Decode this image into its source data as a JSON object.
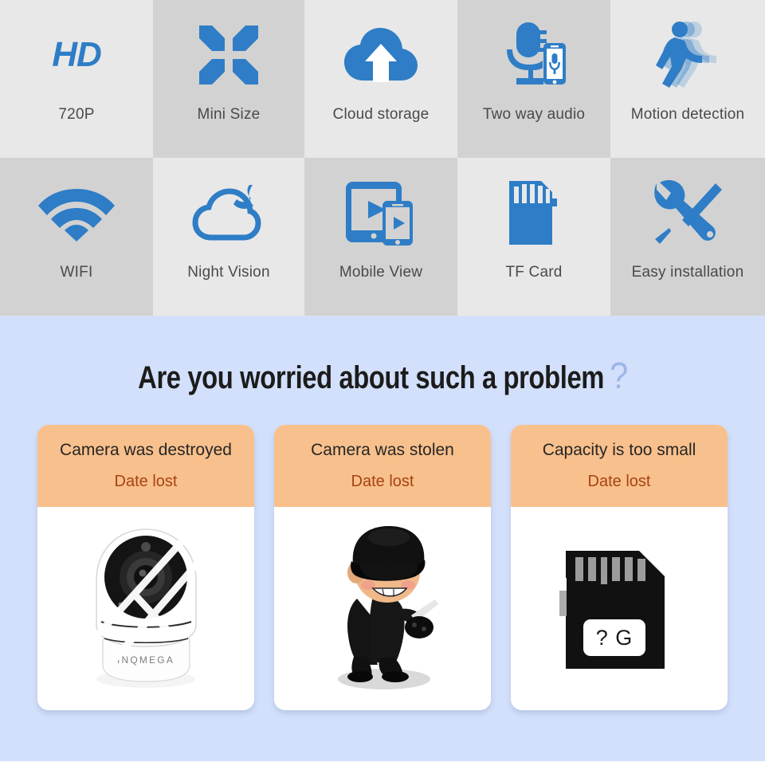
{
  "features": {
    "row1": [
      {
        "icon": "hd-badge-icon",
        "label": "720P",
        "badge_text": "HD",
        "shade": "light"
      },
      {
        "icon": "mini-size-arrows-icon",
        "label": "Mini Size",
        "shade": "dark"
      },
      {
        "icon": "cloud-upload-icon",
        "label": "Cloud storage",
        "shade": "light"
      },
      {
        "icon": "two-way-audio-icon",
        "label": "Two way audio",
        "shade": "dark"
      },
      {
        "icon": "motion-detection-walking-icon",
        "label": "Motion detection",
        "shade": "light"
      }
    ],
    "row2": [
      {
        "icon": "wifi-icon",
        "label": "WIFI",
        "shade": "dark"
      },
      {
        "icon": "night-vision-moon-cloud-icon",
        "label": "Night Vision",
        "shade": "light"
      },
      {
        "icon": "mobile-view-icon",
        "label": "Mobile View",
        "shade": "dark"
      },
      {
        "icon": "tf-card-icon",
        "label": "TF Card",
        "shade": "light"
      },
      {
        "icon": "easy-installation-tools-icon",
        "label": "Easy installation",
        "shade": "dark"
      }
    ]
  },
  "problem": {
    "headline": "Are you worried about such a problem",
    "headline_question_mark": "?",
    "cards": [
      {
        "title": "Camera was destroyed",
        "subtitle": "Date lost",
        "illustration": "broken-camera-illustration",
        "brand_text": "INQMEGA"
      },
      {
        "title": "Camera was stolen",
        "subtitle": "Date lost",
        "illustration": "thief-illustration"
      },
      {
        "title": "Capacity is too small",
        "subtitle": "Date lost",
        "illustration": "sd-card-illustration",
        "sd_label": "? G"
      }
    ]
  },
  "colors": {
    "accent_blue": "#2e7dc6",
    "section_bg": "#d3e0fb",
    "card_header": "#f8c08c",
    "card_subtitle": "#a64314",
    "cell_light": "#e8e8e8",
    "cell_dark": "#d2d2d2",
    "question_mark": "#9bb7e8"
  }
}
